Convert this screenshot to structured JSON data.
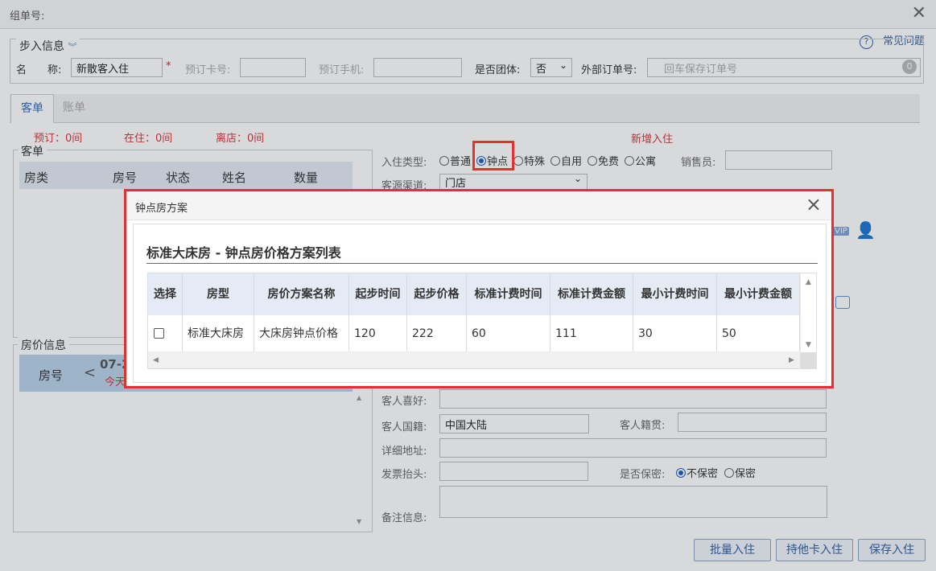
{
  "window": {
    "title": "组单号:",
    "close": "✕"
  },
  "help": {
    "icon": "?",
    "label": "常见问题"
  },
  "steps": {
    "legend": "步入信息",
    "name_label": "名　　称:",
    "name_value": "新散客入住",
    "card_label": "预订卡号:",
    "phone_label": "预订手机:",
    "group_label": "是否团体:",
    "group_value": "否",
    "ext_label": "外部订单号:",
    "ext_placeholder": "回车保存订单号"
  },
  "tabs": [
    {
      "label": "客单"
    },
    {
      "label": "账单"
    }
  ],
  "stats": {
    "booked": "预订：0间",
    "staying": "在住：0间",
    "leaving": "离店：0间"
  },
  "new_checkin": "新增入住",
  "guest_panel": {
    "title": "客单",
    "columns": [
      "房类",
      "房号",
      "状态",
      "姓名",
      "数量"
    ]
  },
  "price_panel": {
    "title": "房价信息",
    "col_room": "房号",
    "date": "07-2",
    "today": "今天"
  },
  "checkin": {
    "type_label": "入住类型:",
    "types": [
      "普通",
      "钟点",
      "特殊",
      "自用",
      "免费",
      "公寓"
    ],
    "selected": "钟点",
    "sales_label": "销售员:",
    "source_label": "客源渠道:",
    "source_value": "门店"
  },
  "form": {
    "hobby_label": "客人喜好:",
    "nation_label": "客人国籍:",
    "nation_value": "中国大陆",
    "native_label": "客人籍贯:",
    "address_label": "详细地址:",
    "invoice_label": "发票抬头:",
    "secret_label": "是否保密:",
    "secret_options": [
      "不保密",
      "保密"
    ],
    "remark_label": "备注信息:"
  },
  "buttons": {
    "batch": "批量入住",
    "card": "持他卡入住",
    "save": "保存入住"
  },
  "modal": {
    "title": "钟点房方案",
    "subtitle": "标准大床房 - 钟点房价格方案列表",
    "columns": [
      "选择",
      "房型",
      "房价方案名称",
      "起步时间",
      "起步价格",
      "标准计费时间",
      "标准计费金额",
      "最小计费时间",
      "最小计费金额"
    ],
    "rows": [
      [
        "",
        "标准大床房",
        "大床房钟点价格",
        "120",
        "222",
        "60",
        "111",
        "30",
        "50"
      ]
    ]
  }
}
